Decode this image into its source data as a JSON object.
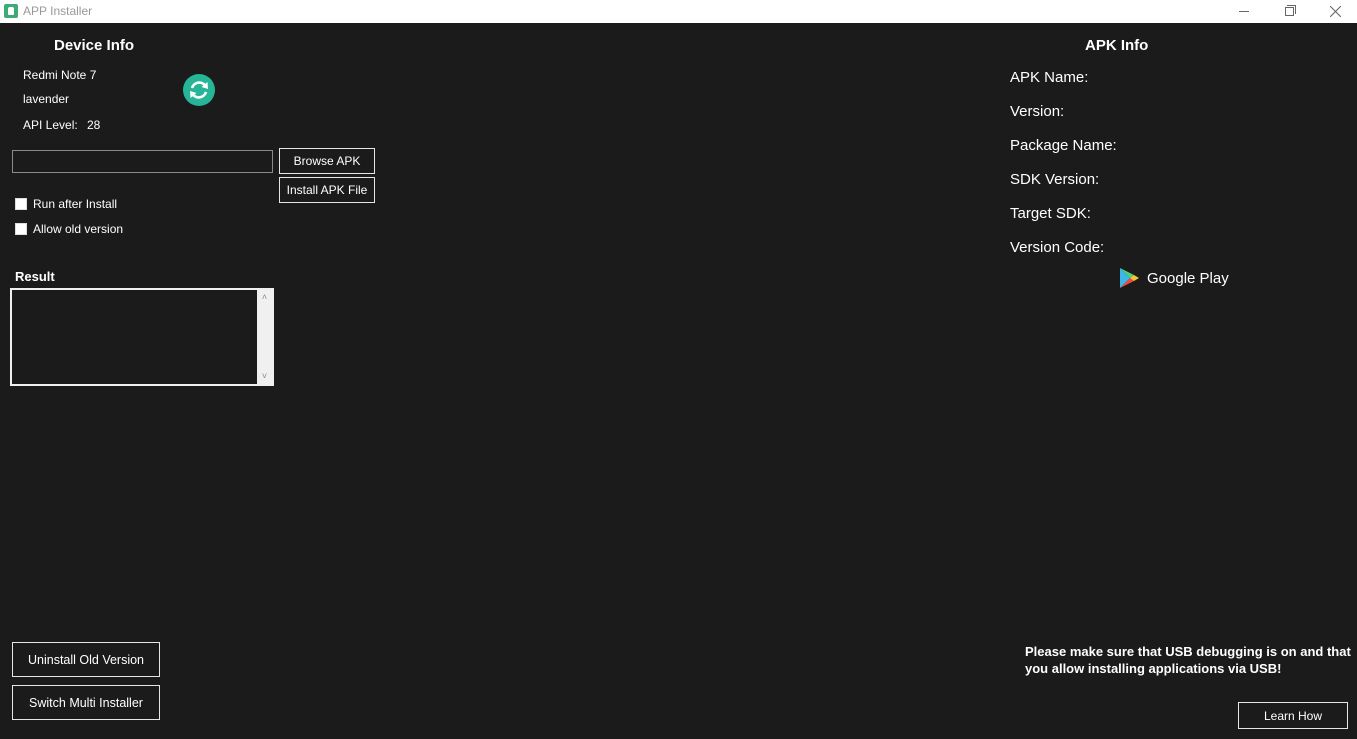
{
  "window": {
    "title": "APP Installer",
    "controls": [
      "minimize",
      "restore",
      "close"
    ]
  },
  "device_info": {
    "heading": "Device Info",
    "model": "Redmi Note 7",
    "codename": "lavender",
    "api_label": "API Level:",
    "api_value": "28"
  },
  "installer": {
    "apk_path_value": "",
    "browse_label": "Browse APK",
    "install_label": "Install APK File",
    "run_after_install_label": "Run after Install",
    "allow_old_version_label": "Allow old version",
    "run_after_install_checked": false,
    "allow_old_version_checked": false
  },
  "result": {
    "heading": "Result",
    "text": ""
  },
  "bottom_left": {
    "uninstall_label": "Uninstall Old Version",
    "switch_label": "Switch Multi Installer"
  },
  "apk_info": {
    "heading": "APK Info",
    "fields": [
      {
        "label": "APK Name:"
      },
      {
        "label": "Version:"
      },
      {
        "label": "Package Name:"
      },
      {
        "label": "SDK Version:"
      },
      {
        "label": "Target SDK:"
      },
      {
        "label": "Version Code:"
      }
    ],
    "google_play_label": "Google Play"
  },
  "notice": {
    "text": "Please make sure that USB debugging is on and that you allow installing applications via USB!",
    "learn_how_label": "Learn How"
  },
  "colors": {
    "background": "#1b1b1b",
    "accent": "#27b597",
    "titlebar": "#ffffff"
  }
}
